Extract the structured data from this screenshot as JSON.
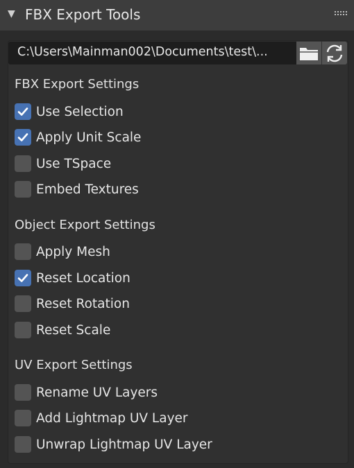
{
  "header": {
    "title": "FBX Export Tools",
    "collapse_icon": "triangle-down-icon",
    "drag_icon": "grip-icon"
  },
  "export_path": {
    "value": "C:\\Users\\Mainman002\\Documents\\test\\..."
  },
  "buttons": {
    "folder_icon": "folder-icon",
    "refresh_icon": "refresh-icon"
  },
  "sections": [
    {
      "title": "FBX Export Settings",
      "options": [
        {
          "label": "Use Selection",
          "checked": true
        },
        {
          "label": "Apply Unit Scale",
          "checked": true
        },
        {
          "label": "Use TSpace",
          "checked": false
        },
        {
          "label": "Embed Textures",
          "checked": false
        }
      ]
    },
    {
      "title": "Object Export Settings",
      "options": [
        {
          "label": "Apply Mesh",
          "checked": false
        },
        {
          "label": "Reset Location",
          "checked": true
        },
        {
          "label": "Reset Rotation",
          "checked": false
        },
        {
          "label": "Reset Scale",
          "checked": false
        }
      ]
    },
    {
      "title": "UV Export Settings",
      "options": [
        {
          "label": "Rename UV Layers",
          "checked": false
        },
        {
          "label": "Add Lightmap UV Layer",
          "checked": false
        },
        {
          "label": "Unwrap Lightmap UV Layer",
          "checked": false
        }
      ]
    }
  ],
  "colors": {
    "checked": "#4772b3",
    "unchecked": "#545454",
    "background": "#2b2b2b"
  }
}
